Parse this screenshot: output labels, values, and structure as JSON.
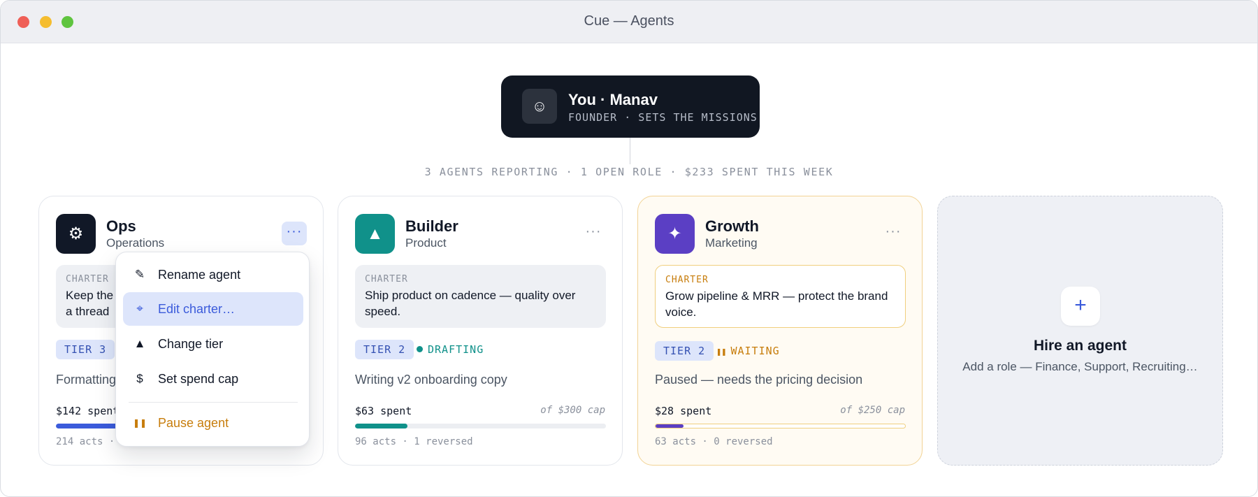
{
  "window": {
    "title": "Cue — Agents"
  },
  "founder": {
    "avatar_glyph": "☺",
    "avatar_icon": "smiley-icon",
    "name": "You · Manav",
    "role": "FOUNDER · SETS THE MISSIONS"
  },
  "summary": "3 AGENTS REPORTING · 1 OPEN ROLE · $233 SPENT THIS WEEK",
  "agents": [
    {
      "name": "Ops",
      "department": "Operations",
      "icon": "gear-icon",
      "icon_glyph": "⚙",
      "icon_color": "#111827",
      "more": "···",
      "charter_label": "CHARTER",
      "charter_line1": "Keep the",
      "charter_line2": "a thread",
      "tier": "TIER 3",
      "activity": "Formatting",
      "spent": "$142 spent",
      "spend_fraction": 0.55,
      "bar_color": "#3b5bdb",
      "meta": "214 acts ·"
    },
    {
      "name": "Builder",
      "department": "Product",
      "icon": "triangle-icon",
      "icon_glyph": "▲",
      "icon_color": "#10918a",
      "more": "···",
      "charter_label": "CHARTER",
      "charter": "Ship product on cadence — quality over speed.",
      "tier": "TIER 2",
      "status": "DRAFTING",
      "status_color": "#10918a",
      "activity": "Writing v2 onboarding copy",
      "spent": "$63 spent",
      "cap": "of $300 cap",
      "spend_fraction": 0.21,
      "bar_color": "#10918a",
      "meta": "96 acts · 1 reversed"
    },
    {
      "name": "Growth",
      "department": "Marketing",
      "icon": "sparkle-icon",
      "icon_glyph": "✦",
      "icon_color": "#5b3fc4",
      "more": "···",
      "charter_label": "CHARTER",
      "charter": "Grow pipeline & MRR — protect the brand voice.",
      "tier": "TIER 2",
      "status": "WAITING",
      "status_color": "#c77d0c",
      "status_glyph": "❚❚",
      "activity": "Paused — needs the pricing decision",
      "spent": "$28 spent",
      "cap": "of $250 cap",
      "spend_fraction": 0.112,
      "bar_color": "#5b3fc4",
      "meta": "63 acts · 0 reversed"
    }
  ],
  "hire": {
    "plus_glyph": "+",
    "title": "Hire an agent",
    "subtitle": "Add a role — Finance, Support, Recruiting…"
  },
  "menu": {
    "items": [
      {
        "label": "Rename agent",
        "glyph": "✎",
        "icon": "pencil-icon"
      },
      {
        "label": "Edit charter…",
        "glyph": "⌖",
        "icon": "crosshair-icon"
      },
      {
        "label": "Change tier",
        "glyph": "▲",
        "icon": "triangle-icon"
      },
      {
        "label": "Set spend cap",
        "glyph": "$",
        "icon": "dollar-icon"
      },
      {
        "label": "Pause agent",
        "glyph": "❚❚",
        "icon": "pause-icon"
      }
    ]
  },
  "colors": {
    "accent": "#3b5bdb",
    "teal": "#10918a",
    "amber": "#c77d0c",
    "violet": "#5b3fc4",
    "dark": "#111722"
  }
}
